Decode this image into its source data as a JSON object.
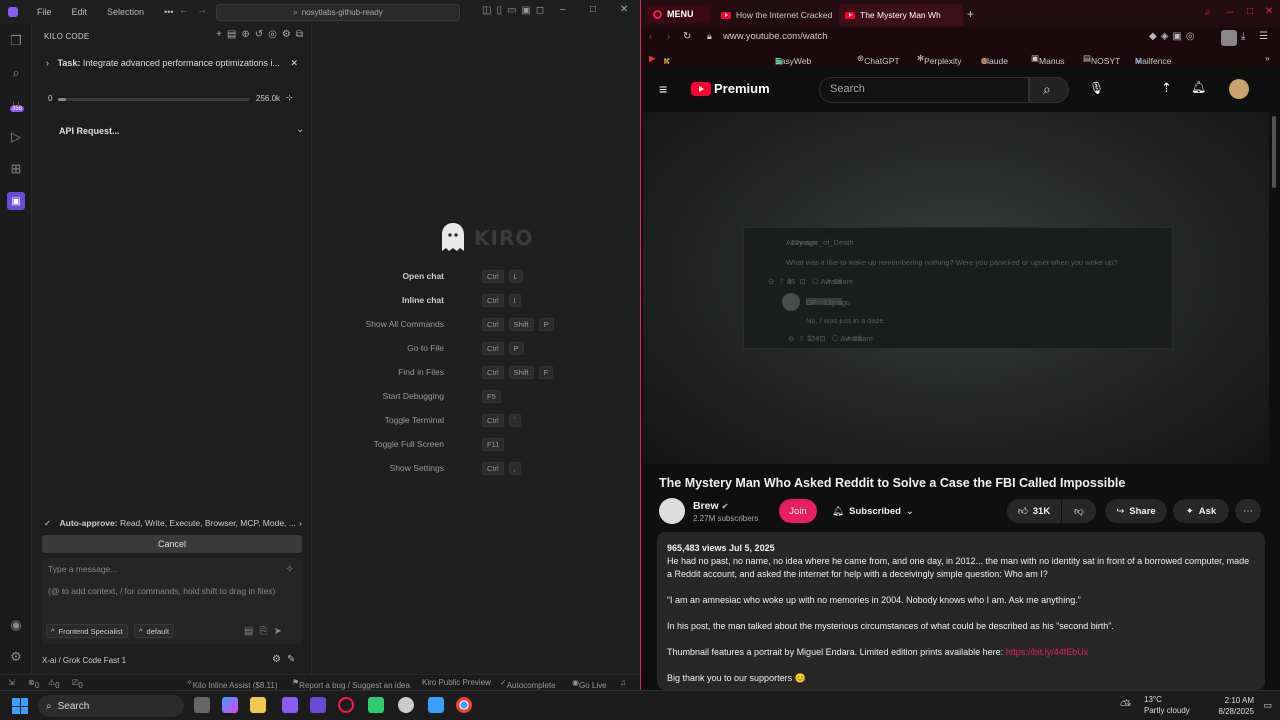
{
  "ide": {
    "menus": [
      "File",
      "Edit",
      "Selection",
      "•••"
    ],
    "command_center": "nosytlabs-github-ready",
    "panel_title": "KILO CODE",
    "task_label": "Task:",
    "task_text": "Integrate advanced performance optimizations i...",
    "context_start": "0",
    "context_end": "256.0k",
    "api_request": "API Request...",
    "auto_approve_label": "Auto-approve:",
    "auto_approve_text": "Read, Write, Execute, Browser, MCP, Mode, ...",
    "cancel_label": "Cancel",
    "message_placeholder": "Type a message...",
    "message_hint": "(@ to add context, / for commands, hold shift to drag in files)",
    "mode_chip": "Frontend Specialist",
    "profile_chip": "default",
    "model": "X-ai / Grok Code Fast 1",
    "activity_badge": "358",
    "welcome": {
      "logo_text": "KIRO",
      "shortcuts": [
        {
          "label": "Open chat",
          "keys": [
            "Ctrl",
            "L"
          ],
          "bold": true
        },
        {
          "label": "Inline chat",
          "keys": [
            "Ctrl",
            "I"
          ],
          "bold": true
        },
        {
          "label": "Show All Commands",
          "keys": [
            "Ctrl",
            "Shift",
            "P"
          ]
        },
        {
          "label": "Go to File",
          "keys": [
            "Ctrl",
            "P"
          ]
        },
        {
          "label": "Find in Files",
          "keys": [
            "Ctrl",
            "Shift",
            "F"
          ]
        },
        {
          "label": "Start Debugging",
          "keys": [
            "F5"
          ]
        },
        {
          "label": "Toggle Terminal",
          "keys": [
            "Ctrl",
            "`"
          ]
        },
        {
          "label": "Toggle Full Screen",
          "keys": [
            "F11"
          ]
        },
        {
          "label": "Show Settings",
          "keys": [
            "Ctrl",
            ","
          ]
        }
      ]
    },
    "status": {
      "errors": "0",
      "warnings": "0",
      "ports": "0",
      "inline_assist": "Kilo Inline Assist ($8.11)",
      "report": "Report a bug / Suggest an idea",
      "public_preview": "Kiro Public Preview",
      "autocomplete": "Autocomplete",
      "go_live": "Go Live"
    }
  },
  "browser": {
    "menu_label": "MENU",
    "tabs": [
      {
        "title": "How the Internet Cracked"
      },
      {
        "title": "The Mystery Man Wh"
      }
    ],
    "url": "www.youtube.com/watch",
    "bookmarks": [
      "EasyWeb",
      "ChatGPT",
      "Perplexity",
      "Claude",
      "Manus",
      "NOSYT",
      "Mailfence"
    ],
    "youtube": {
      "brand": "Premium",
      "search_placeholder": "Search",
      "video_title": "The Mystery Man Who Asked Reddit to Solve a Case the FBI Called Impossible",
      "channel": "Brew",
      "subscribers": "2.27M subscribers",
      "join_label": "Join",
      "subscribed_label": "Subscribed",
      "likes": "31K",
      "share_label": "Share",
      "ask_label": "Ask",
      "screenshot_user": "Amnesiac_of_Death",
      "screenshot_age": "· 13y ago",
      "screenshot_question": "What was it like to wake up remembering nothing? Were you panicked or upset when you woke up?",
      "screenshot_votes": "85",
      "screenshot_award": "Award",
      "screenshot_share": "Share",
      "screenshot_reply_tag": "OP · 13y ago",
      "screenshot_reply": "No, I was just in a daze.",
      "screenshot_reply_votes": "124",
      "description": {
        "stats": "965,483 views  Jul 5, 2025",
        "para1": "He had no past, no name, no idea where he came from, and one day, in 2012... the man with no identity sat in front of a borrowed computer, made a Reddit account, and asked the internet for help with a deceivingly simple question: Who am I?",
        "para2": "“I am an amnesiac who woke up with no memories in 2004. Nobody knows who I am. Ask me anything.”",
        "para3": "In his post, the man talked about the mysterious circumstances of what could be described as his “second birth”.",
        "para4_prefix": "Thumbnail features a portrait by Miguel Endara. Limited edition prints available here: ",
        "para4_link": "https://bit.ly/44fEbUx",
        "para5": "Big thank you to our supporters 😊"
      }
    }
  },
  "taskbar": {
    "search_label": "Search",
    "weather_temp": "13°C",
    "weather_desc": "Partly cloudy",
    "time": "2:10 AM",
    "date": "8/28/2025"
  },
  "colors": {
    "accent_red": "#ff0033",
    "opera_red": "#e0245e",
    "join_pink": "#e91e63"
  }
}
